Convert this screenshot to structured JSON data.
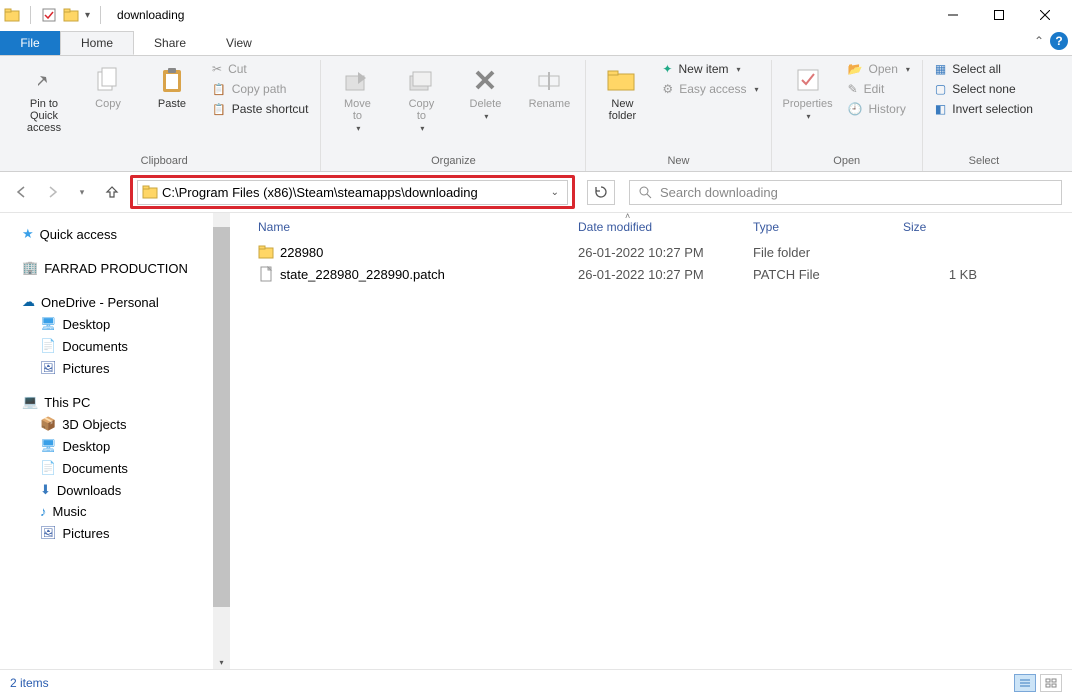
{
  "window": {
    "title": "downloading"
  },
  "tabs": {
    "file": "File",
    "home": "Home",
    "share": "Share",
    "view": "View"
  },
  "ribbon": {
    "clipboard": {
      "label": "Clipboard",
      "pin": "Pin to Quick\naccess",
      "copy": "Copy",
      "paste": "Paste",
      "cut": "Cut",
      "copy_path": "Copy path",
      "paste_shortcut": "Paste shortcut"
    },
    "organize": {
      "label": "Organize",
      "move_to": "Move\nto",
      "copy_to": "Copy\nto",
      "delete": "Delete",
      "rename": "Rename"
    },
    "new_group": {
      "label": "New",
      "new_folder": "New\nfolder",
      "new_item": "New item",
      "easy_access": "Easy access"
    },
    "open_group": {
      "label": "Open",
      "properties": "Properties",
      "open": "Open",
      "edit": "Edit",
      "history": "History"
    },
    "select": {
      "label": "Select",
      "select_all": "Select all",
      "select_none": "Select none",
      "invert": "Invert selection"
    }
  },
  "address": {
    "path": "C:\\Program Files (x86)\\Steam\\steamapps\\downloading"
  },
  "search": {
    "placeholder": "Search downloading"
  },
  "columns": {
    "name": "Name",
    "date": "Date modified",
    "type": "Type",
    "size": "Size"
  },
  "files": [
    {
      "name": "228980",
      "date": "26-01-2022 10:27 PM",
      "type": "File folder",
      "size": "",
      "icon": "folder"
    },
    {
      "name": "state_228980_228990.patch",
      "date": "26-01-2022 10:27 PM",
      "type": "PATCH File",
      "size": "1 KB",
      "icon": "file"
    }
  ],
  "nav": {
    "quick_access": "Quick access",
    "farrad": "FARRAD PRODUCTION",
    "onedrive": "OneDrive - Personal",
    "od_desktop": "Desktop",
    "od_docs": "Documents",
    "od_pics": "Pictures",
    "this_pc": "This PC",
    "pc_3d": "3D Objects",
    "pc_desktop": "Desktop",
    "pc_docs": "Documents",
    "pc_downloads": "Downloads",
    "pc_music": "Music",
    "pc_pics": "Pictures"
  },
  "status": {
    "items": "2 items"
  }
}
